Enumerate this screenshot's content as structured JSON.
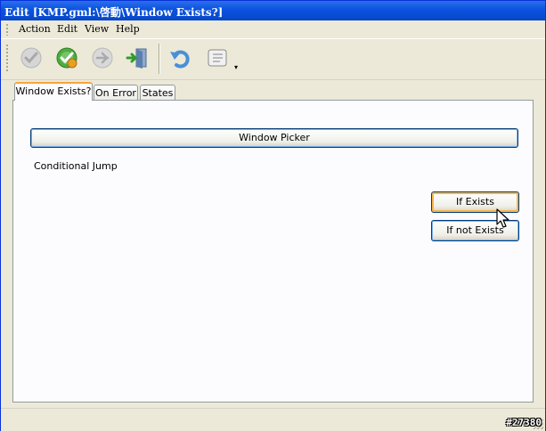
{
  "window": {
    "title": "Edit [KMP.gml:\\啓動\\Window Exists?]"
  },
  "menubar": {
    "items": [
      "Action",
      "Edit",
      "View",
      "Help"
    ]
  },
  "toolbar": {
    "buttons": [
      {
        "icon": "check-icon",
        "enabled": false
      },
      {
        "icon": "apply-icon",
        "enabled": true
      },
      {
        "icon": "cancel-icon",
        "enabled": false
      },
      {
        "icon": "exit-icon",
        "enabled": true
      },
      {
        "icon": "undo-icon",
        "enabled": true
      },
      {
        "icon": "script-icon",
        "enabled": true
      }
    ],
    "dropdown_glyph": "▾"
  },
  "tabs": [
    {
      "label": "Window Exists?",
      "active": true
    },
    {
      "label": "On Error",
      "active": false
    },
    {
      "label": "States",
      "active": false
    }
  ],
  "panel": {
    "picker_label": "Window Picker",
    "conditional_label": "Conditional Jump",
    "if_exists_label": "If Exists",
    "if_not_exists_label": "If not Exists"
  },
  "watermark": "#27380",
  "colors": {
    "titlebar": "#0a52e0",
    "tab_accent": "#f7a53d",
    "button_border": "#003c74",
    "hover_highlight": "#f9b64a"
  }
}
